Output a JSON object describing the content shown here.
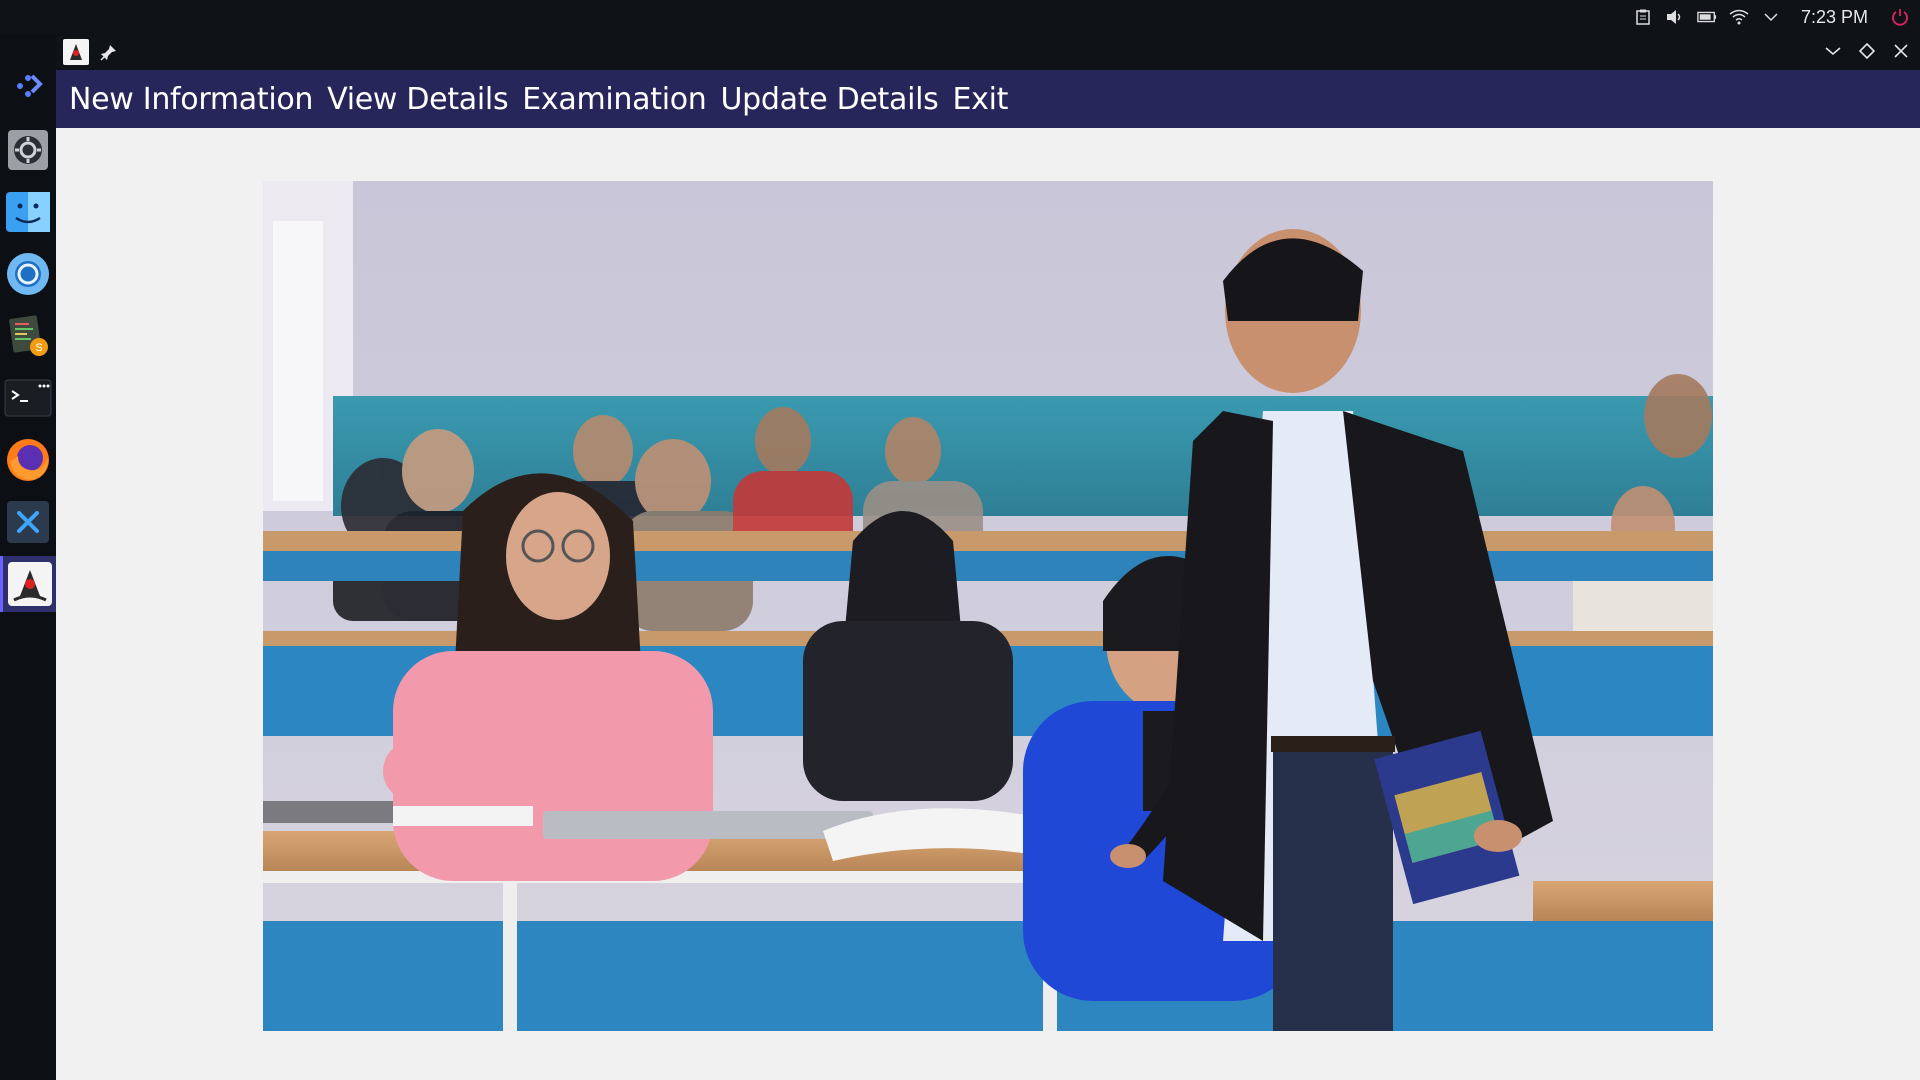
{
  "system_tray": {
    "icons": [
      "clipboard-icon",
      "volume-icon",
      "battery-icon",
      "wifi-icon",
      "chevron-down-icon"
    ],
    "clock": "7:23 PM",
    "power_icon": "power-icon"
  },
  "dock": {
    "items": [
      {
        "name": "launcher-icon"
      },
      {
        "name": "system-settings-icon"
      },
      {
        "name": "finder-icon"
      },
      {
        "name": "browser-icon"
      },
      {
        "name": "code-editor-icon"
      },
      {
        "name": "terminal-icon"
      },
      {
        "name": "firefox-icon"
      },
      {
        "name": "vscode-icon"
      },
      {
        "name": "java-app-icon",
        "active": true
      }
    ]
  },
  "window": {
    "controls": [
      "minimize-icon",
      "maximize-icon",
      "close-icon"
    ]
  },
  "menu": {
    "items": [
      {
        "label": "New Information"
      },
      {
        "label": "View Details"
      },
      {
        "label": "Examination"
      },
      {
        "label": "Update Details"
      },
      {
        "label": "Exit"
      }
    ]
  },
  "colors": {
    "menubar": "#27265a",
    "content_bg": "#f1f1f1",
    "topbar": "#0f1318",
    "dock_active": "#2f2f6c"
  }
}
